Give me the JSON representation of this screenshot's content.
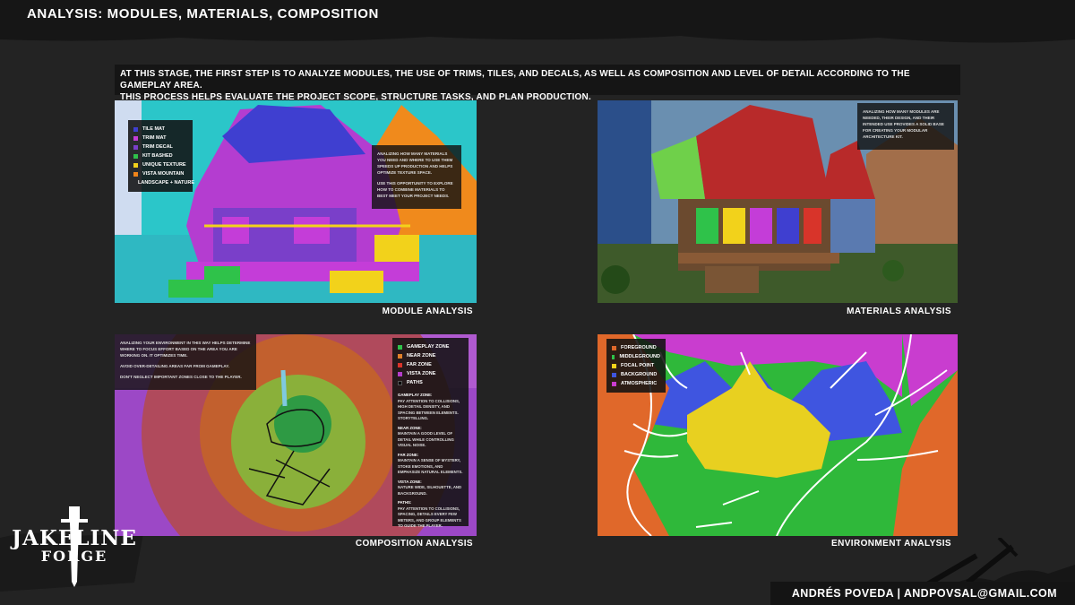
{
  "header": {
    "title": "ANALYSIS: MODULES, MATERIALS, COMPOSITION"
  },
  "intro": {
    "line1": "AT THIS STAGE, THE FIRST STEP IS TO ANALYZE MODULES, THE USE OF TRIMS, TILES, AND DECALS, AS WELL AS COMPOSITION AND LEVEL OF DETAIL ACCORDING TO THE GAMEPLAY AREA.",
    "line2": "THIS PROCESS HELPS EVALUATE THE PROJECT SCOPE, STRUCTURE TASKS, AND PLAN PRODUCTION."
  },
  "panels": {
    "module": {
      "label": "MODULE ANALYSIS",
      "legend": [
        {
          "label": "TILE MAT",
          "color": "#3f3fd0"
        },
        {
          "label": "TRIM MAT",
          "color": "#c43dd8"
        },
        {
          "label": "TRIM DECAL",
          "color": "#7a3fc9"
        },
        {
          "label": "KIT BASHED",
          "color": "#2fc24a"
        },
        {
          "label": "UNIQUE TEXTURE",
          "color": "#f2d21b"
        },
        {
          "label": "VISTA MOUNTAIN",
          "color": "#f0841a"
        },
        {
          "label": "LANDSCAPE + NATURE",
          "color": "#33c3c8"
        }
      ],
      "note": [
        "ANALIZING HOW MANY MATERIALS YOU NEED AND WHERE TO USE THEM SPEEDS UP PRODUCTION AND HELPS OPTIMIZE TEXTURE SPACE.",
        "USE THIS OPPORTUNITY TO EXPLORE HOW TO COMBINE MATERIALS TO BEST MEET YOUR PROJECT NEEDS."
      ]
    },
    "materials": {
      "label": "MATERIALS ANALYSIS",
      "note": [
        "ANALIZING HOW MANY MODULES ARE NEEDED, THEIR DESIGN, AND THEIR INTENDED USE PROVIDES A SOLID BASE FOR CREATING YOUR MODULAR ARCHITECTURE KIT."
      ]
    },
    "composition": {
      "label": "COMPOSITION ANALYSIS",
      "legend": [
        {
          "label": "GAMEPLAY ZONE",
          "color": "#2fc24a"
        },
        {
          "label": "NEAR ZONE",
          "color": "#e0802a"
        },
        {
          "label": "FAR ZONE",
          "color": "#d8342a"
        },
        {
          "label": "VISTA ZONE",
          "color": "#b43dc9"
        },
        {
          "label": "PATHS",
          "color": "#000000"
        }
      ],
      "note": [
        "ANALIZING YOUR ENVIRONMENT IN THIS WAY HELPS DETERMINE WHERE TO FOCUS EFFORT BASED ON THE AREA YOU ARE WORKING ON. IT OPTIMIZES TIME.",
        "AVOID OVER-DETAILING AREAS FAR FROM GAMEPLAY.",
        "DON'T NEGLECT IMPORTANT ZONES CLOSE TO THE PLAYER."
      ],
      "side": [
        {
          "title": "GAMEPLAY ZONE:",
          "text": "PAY ATTENTION TO COLLISIONS, HIGH DETAIL DENSITY, AND SPACING BETWEEN ELEMENTS. STORYTELLING."
        },
        {
          "title": "NEAR ZONE:",
          "text": "MAINTAIN A GOOD LEVEL OF DETAIL WHILE CONTROLLING VISUAL NOISE."
        },
        {
          "title": "FAR ZONE:",
          "text": "MAINTAIN A SENSE OF MYSTERY, STOKE EMOTIONS, AND EMPHASIZE NATURAL ELEMENTS."
        },
        {
          "title": "VISTA ZONE:",
          "text": "NATURE WIDE, SILHOUETTE, AND BACKGROUND."
        },
        {
          "title": "PATHS:",
          "text": "PAY ATTENTION TO COLLISIONS, SPACING, DETAILS EVERY FEW METERS, AND GROUP ELEMENTS TO GUIDE THE PLAYER."
        }
      ]
    },
    "environment": {
      "label": "ENVIRONMENT ANALYSIS",
      "legend": [
        {
          "label": "FOREGROUND",
          "color": "#e0682a"
        },
        {
          "label": "MIDDLEGROUND",
          "color": "#2fc24a"
        },
        {
          "label": "FOCAL POINT",
          "color": "#f2d21b"
        },
        {
          "label": "BACKGROUND",
          "color": "#3f55e0"
        },
        {
          "label": "ATMOSPHERIC",
          "color": "#c93dcf"
        }
      ]
    }
  },
  "logo": {
    "line1": "JAKELINE",
    "line2": "FORGE"
  },
  "footer": {
    "credit": "ANDRÉS POVEDA | ANDPOVSAL@GMAIL.COM"
  }
}
